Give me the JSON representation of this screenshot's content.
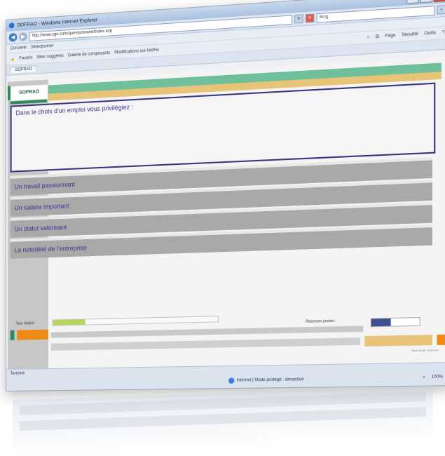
{
  "window": {
    "title": "SOFRAO - Windows Internet Explorer",
    "min_label": "–",
    "max_label": "□",
    "close_label": "✕"
  },
  "address": {
    "url": "http://www.sgo.com/questionnaire/index.asp",
    "search_placeholder": "Bing",
    "back_icon": "back-arrow-icon",
    "forward_icon": "forward-arrow-icon"
  },
  "links_bar": {
    "items": [
      "Convertir",
      "Sélectionner"
    ]
  },
  "favorites_bar": {
    "favorites_label": "Favoris",
    "sites": [
      "Sites suggérés",
      "Galerie de composants",
      "Modifications sur HotFix"
    ],
    "tools": [
      "Page",
      "Sécurité",
      "Outils"
    ]
  },
  "tab": {
    "label": "SOFRAO"
  },
  "page": {
    "logo": "SOFRAO",
    "header_green_text": "",
    "header_yellow_text": "",
    "question": "Dans le choix d'un emploi vous privilégiez :",
    "options": [
      "Un travail passionnant",
      "Un salaire important",
      "Un statut valorisant",
      "La notoriété de l'entreprise"
    ],
    "progress_label": "Taux réalisé :",
    "progress_percent": 20,
    "answers_label": "Réponses jouées :",
    "answers_percent": 40,
    "footer_text": "",
    "legal_text": "Tous droits réservés"
  },
  "status": {
    "done": "Terminé",
    "zone": "Internet | Mode protégé : désactivé",
    "zoom": "100%"
  },
  "colors": {
    "accent_green": "#6fbf9b",
    "accent_yellow": "#e8c478",
    "accent_orange": "#ee8a18",
    "question_text": "#3b3590"
  }
}
